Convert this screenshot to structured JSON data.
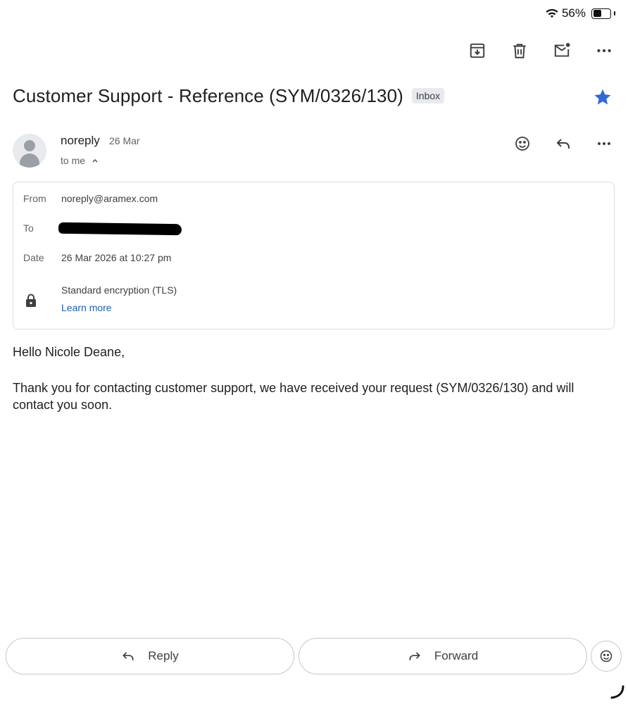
{
  "status_bar": {
    "battery_text": "56%",
    "battery_level": 0.56
  },
  "toolbar": {
    "archive_icon": "archive-icon",
    "delete_icon": "trash-icon",
    "mark_unread_icon": "mark-unread-icon",
    "more_icon": "more-horizontal-icon"
  },
  "email": {
    "subject": "Customer Support - Reference (SYM/0326/130)",
    "label": "Inbox",
    "starred": true,
    "star_color": "#3367d6",
    "sender_name": "noreply",
    "sender_date": "26 Mar",
    "recipient_summary": "to me",
    "details": {
      "from_label": "From",
      "from_value": "noreply@aramex.com",
      "to_label": "To",
      "date_label": "Date",
      "date_value": "26 Mar 2026 at 10:27 pm",
      "encryption": "Standard encryption (TLS)",
      "learn_more": "Learn more"
    },
    "greeting": "Hello Nicole Deane,",
    "body": "Thank you for contacting customer support, we have received your request (SYM/0326/130) and will contact you soon."
  },
  "actions": {
    "reply": "Reply",
    "forward": "Forward"
  },
  "colors": {
    "link": "#1a5fb4",
    "chip_bg": "#e8eaed",
    "border": "#dadce0"
  }
}
